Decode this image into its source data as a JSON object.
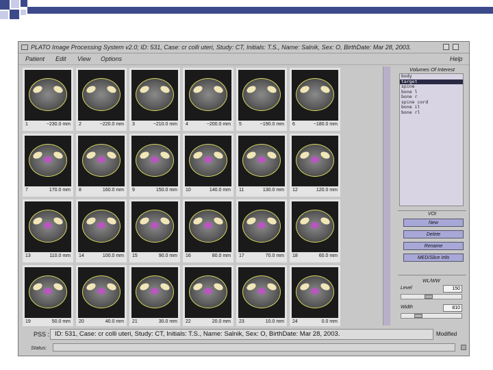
{
  "window": {
    "title": "PLATO Image Processing System v2.0;  ID: 531,  Case: cr colli uteri,  Study: CT,  Initials: T.S.,  Name: Salnik,  Sex: O,  BirthDate: Mar 28, 2003."
  },
  "menu": {
    "patient": "Patient",
    "edit": "Edit",
    "view": "View",
    "options": "Options",
    "help": "Help"
  },
  "slices": [
    {
      "n": "1",
      "pos": "−230.0 mm"
    },
    {
      "n": "2",
      "pos": "−220.0 mm"
    },
    {
      "n": "3",
      "pos": "−210.0 mm"
    },
    {
      "n": "4",
      "pos": "−200.0 mm"
    },
    {
      "n": "5",
      "pos": "−190.0 mm"
    },
    {
      "n": "6",
      "pos": "−180.0 mm"
    },
    {
      "n": "7",
      "pos": "170.0 mm"
    },
    {
      "n": "8",
      "pos": "160.0 mm"
    },
    {
      "n": "9",
      "pos": "150.0 mm"
    },
    {
      "n": "10",
      "pos": "140.0 mm"
    },
    {
      "n": "11",
      "pos": "130.0 mm"
    },
    {
      "n": "12",
      "pos": "120.0 mm"
    },
    {
      "n": "13",
      "pos": "110.0 mm"
    },
    {
      "n": "14",
      "pos": "100.0 mm"
    },
    {
      "n": "15",
      "pos": "90.0 mm"
    },
    {
      "n": "16",
      "pos": "80.0 mm"
    },
    {
      "n": "17",
      "pos": "70.0 mm"
    },
    {
      "n": "18",
      "pos": "60.0 mm"
    },
    {
      "n": "19",
      "pos": "50.0 mm"
    },
    {
      "n": "20",
      "pos": "40.0 mm"
    },
    {
      "n": "21",
      "pos": "30.0 mm"
    },
    {
      "n": "22",
      "pos": "20.0 mm"
    },
    {
      "n": "23",
      "pos": "10.0 mm"
    },
    {
      "n": "24",
      "pos": "0.0 mm"
    }
  ],
  "voi": {
    "title": "Volumes Of Interest",
    "items": [
      "body",
      "target",
      "spine",
      "bone l",
      "bone r",
      "spine cord",
      "bone il",
      "bone rl"
    ],
    "selected_index": 1,
    "section_label": "VOI",
    "buttons": {
      "new": "New",
      "delete": "Delete",
      "rename": "Rename",
      "med": "MED/Slice Info"
    }
  },
  "wlww": {
    "title": "WL/WW",
    "level_label": "Level",
    "level_value": "150",
    "width_label": "Width",
    "width_value": "810",
    "level_fraction": 0.45,
    "width_fraction": 0.25
  },
  "pss": {
    "label": "PSS :",
    "text": "ID: 531,  Case: cr colli uteri,  Study: CT,  Initials: T.S.,  Name: Salnik,  Sex: O,  BirthDate: Mar 28, 2003."
  },
  "modified": "Modified",
  "status_label": "Status:",
  "colors": {
    "slide_bar": "#3c4a8c",
    "deco_dark": "#3c4a8c",
    "deco_light": "#c8cce8",
    "button": "#a8a8d8",
    "target": "#c050c8"
  }
}
